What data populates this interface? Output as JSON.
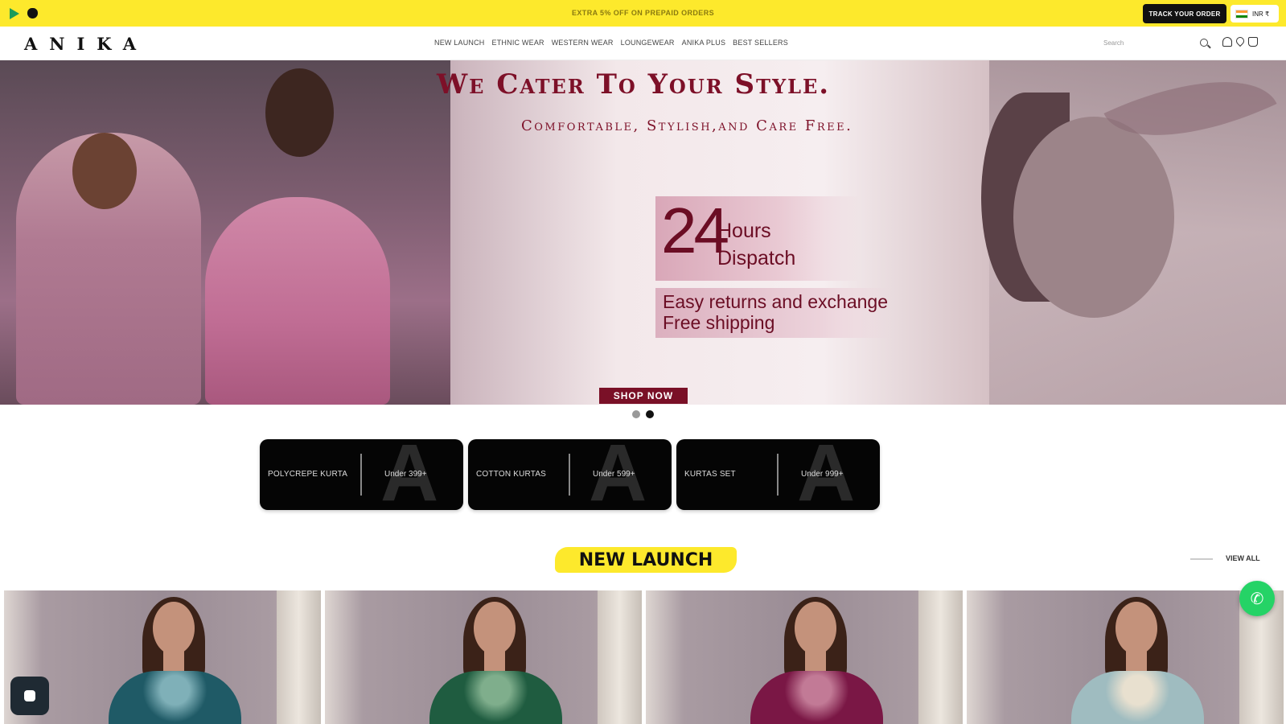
{
  "announcement": {
    "text": "EXTRA 5% OFF ON PREPAID ORDERS",
    "track_label": "TRACK YOUR ORDER",
    "currency": "INR ₹"
  },
  "header": {
    "logo": "ANIKA",
    "nav": [
      "NEW LAUNCH",
      "ETHNIC WEAR",
      "WESTERN WEAR",
      "LOUNGEWEAR",
      "ANIKA PLUS",
      "BEST SELLERS"
    ],
    "search_placeholder": "Search"
  },
  "hero": {
    "title": "We Cater To Your Style.",
    "subtitle": "Comfortable, Stylish,and Care Free.",
    "dispatch_number": "24",
    "dispatch_line1": "Hours",
    "dispatch_line2": "Dispatch",
    "returns_line1": "Easy returns and exchange",
    "returns_line2": "Free shipping",
    "cta": "SHOP NOW"
  },
  "categories": [
    {
      "name": "POLYCREPE KURTA",
      "price": "Under 399+",
      "mark": "A"
    },
    {
      "name": "COTTON KURTAS",
      "price": "Under 599+",
      "mark": "A"
    },
    {
      "name": "KURTAS SET",
      "price": "Under 999+",
      "mark": "A"
    }
  ],
  "section": {
    "title": "NEW LAUNCH",
    "view_all": "VIEW ALL"
  },
  "products": [
    {
      "outfit_color": "#1f5a66",
      "accent_color": "#7fb0b8"
    },
    {
      "outfit_color": "#1f5c40",
      "accent_color": "#7fae8c"
    },
    {
      "outfit_color": "#7a1745",
      "accent_color": "#c27a96"
    },
    {
      "outfit_color": "#9fbcc0",
      "accent_color": "#e8e0cf"
    }
  ],
  "colors": {
    "accent_yellow": "#fde92c",
    "brand_maroon": "#7a1027",
    "whatsapp_green": "#25d366"
  },
  "icons": [
    "google-play-icon",
    "apple-icon",
    "india-flag-icon",
    "search-icon",
    "user-icon",
    "heart-icon",
    "bag-icon",
    "whatsapp-icon",
    "chat-icon"
  ]
}
